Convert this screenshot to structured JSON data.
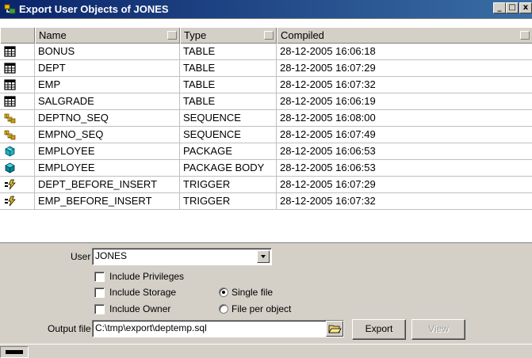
{
  "window": {
    "title": "Export User Objects of JONES",
    "controls": {
      "minimize": "_",
      "maximize": "□",
      "close": "x"
    }
  },
  "list": {
    "columns": [
      "Name",
      "Type",
      "Compiled"
    ],
    "rows": [
      {
        "icon": "table-icon",
        "name": "BONUS",
        "type": "TABLE",
        "compiled": "28-12-2005 16:06:18"
      },
      {
        "icon": "table-icon",
        "name": "DEPT",
        "type": "TABLE",
        "compiled": "28-12-2005 16:07:29"
      },
      {
        "icon": "table-icon",
        "name": "EMP",
        "type": "TABLE",
        "compiled": "28-12-2005 16:07:32"
      },
      {
        "icon": "table-icon",
        "name": "SALGRADE",
        "type": "TABLE",
        "compiled": "28-12-2005 16:06:19"
      },
      {
        "icon": "sequence-icon",
        "name": "DEPTNO_SEQ",
        "type": "SEQUENCE",
        "compiled": "28-12-2005 16:08:00"
      },
      {
        "icon": "sequence-icon",
        "name": "EMPNO_SEQ",
        "type": "SEQUENCE",
        "compiled": "28-12-2005 16:07:49"
      },
      {
        "icon": "package-icon",
        "name": "EMPLOYEE",
        "type": "PACKAGE",
        "compiled": "28-12-2005 16:06:53"
      },
      {
        "icon": "package-body-icon",
        "name": "EMPLOYEE",
        "type": "PACKAGE BODY",
        "compiled": "28-12-2005 16:06:53"
      },
      {
        "icon": "trigger-icon",
        "name": "DEPT_BEFORE_INSERT",
        "type": "TRIGGER",
        "compiled": "28-12-2005 16:07:29"
      },
      {
        "icon": "trigger-icon",
        "name": "EMP_BEFORE_INSERT",
        "type": "TRIGGER",
        "compiled": "28-12-2005 16:07:32"
      }
    ]
  },
  "options": {
    "user_label": "User",
    "user_value": "JONES",
    "include_privileges": "Include Privileges",
    "include_storage": "Include Storage",
    "include_owner": "Include Owner",
    "single_file": "Single file",
    "file_per_object": "File per object",
    "output_label": "Output file",
    "output_value": "C:\\tmp\\export\\deptemp.sql",
    "export_button": "Export",
    "view_button": "View"
  },
  "colors": {
    "titlebar_start": "#0a246a",
    "titlebar_end": "#3a6ea5",
    "panel": "#d4d0c8"
  }
}
